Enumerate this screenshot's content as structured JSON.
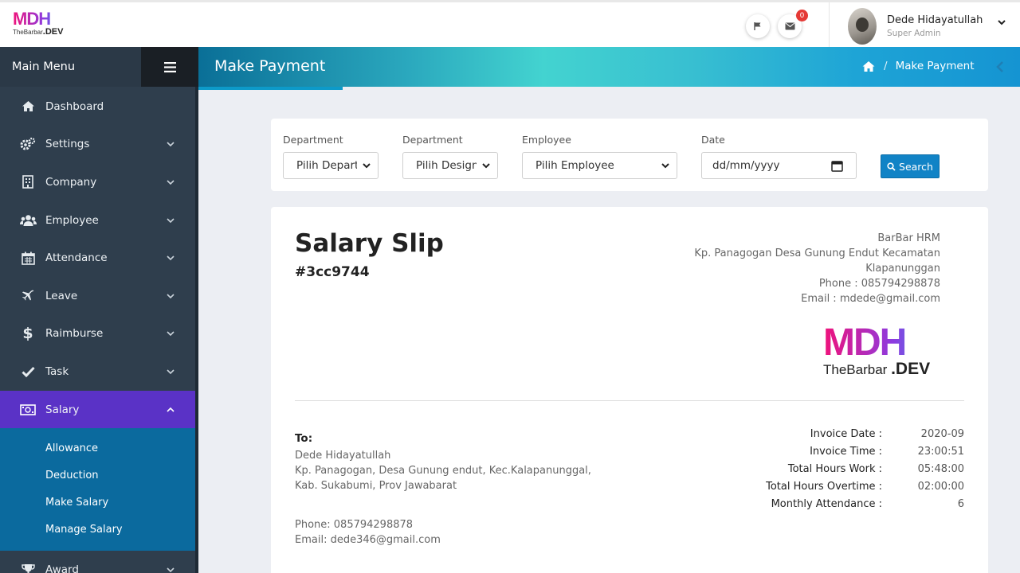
{
  "brand": {
    "logo_main": "MDH",
    "logo_sub": "TheBarbar",
    "logo_dev": ".DEV"
  },
  "topbar": {
    "notification_count": "0",
    "user_name": "Dede Hidayatullah",
    "user_role": "Super Admin"
  },
  "sidebar": {
    "title": "Main Menu",
    "items": [
      {
        "label": "Dashboard",
        "icon": "home-icon"
      },
      {
        "label": "Settings",
        "icon": "gears-icon"
      },
      {
        "label": "Company",
        "icon": "building-icon"
      },
      {
        "label": "Employee",
        "icon": "users-icon"
      },
      {
        "label": "Attendance",
        "icon": "calendar-icon"
      },
      {
        "label": "Leave",
        "icon": "plane-icon"
      },
      {
        "label": "Raimburse",
        "icon": "dollar-icon"
      },
      {
        "label": "Task",
        "icon": "check-icon"
      },
      {
        "label": "Salary",
        "icon": "money-icon"
      },
      {
        "label": "Award",
        "icon": "trophy-icon"
      }
    ],
    "salary_submenu": [
      "Allowance",
      "Deduction",
      "Make Salary",
      "Manage Salary"
    ]
  },
  "page_header": {
    "title": "Make Payment",
    "breadcrumb_current": "Make Payment"
  },
  "filters": {
    "department_label_1": "Department",
    "department_value": "Pilih Departr",
    "department_label_2": "Department",
    "designation_value": "Pilih Design",
    "employee_label": "Employee",
    "employee_value": "Pilih Employee",
    "date_label": "Date",
    "date_placeholder": "dd/mm/yyyy",
    "search_label": "Search"
  },
  "slip": {
    "title": "Salary Slip",
    "number": "#3cc9744",
    "company_name": "BarBar HRM",
    "company_address_1": "Kp. Panagogan Desa Gunung Endut Kecamatan",
    "company_address_2": "Klapanunggan",
    "company_phone": "Phone : 085794298878",
    "company_email": "Email : mdede@gmail.com",
    "to_label": "To:",
    "to_name": "Dede Hidayatullah",
    "to_address": "Kp. Panagogan, Desa Gunung endut, Kec.Kalapanunggal, Kab. Sukabumi, Prov Jawabarat",
    "to_phone": "Phone: 085794298878",
    "to_email": "Email: dede346@gmail.com",
    "invoice": [
      {
        "k": "Invoice Date :",
        "v": "2020-09"
      },
      {
        "k": "Invoice Time :",
        "v": "23:00:51"
      },
      {
        "k": "Total Hours Work :",
        "v": "05:48:00"
      },
      {
        "k": "Total Hours Overtime :",
        "v": "02:00:00"
      },
      {
        "k": "Monthly Attendance :",
        "v": "6"
      }
    ]
  },
  "colors": {
    "sidebar": "#2f3e4d",
    "active": "#5a32c6",
    "submenu": "#0b6a9e",
    "button": "#1183c6"
  }
}
